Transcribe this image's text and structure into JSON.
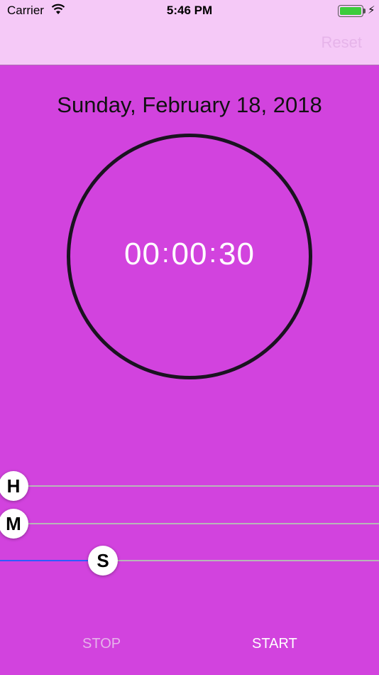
{
  "status_bar": {
    "carrier": "Carrier",
    "time": "5:46 PM",
    "battery_color": "#3ccc3c"
  },
  "nav": {
    "reset_label": "Reset"
  },
  "date": "Sunday, February 18, 2018",
  "timer": {
    "hours": "00",
    "minutes": "00",
    "seconds": "30",
    "separator": ":"
  },
  "sliders": [
    {
      "label": "H",
      "value": 0,
      "max": 23
    },
    {
      "label": "M",
      "value": 0,
      "max": 59
    },
    {
      "label": "S",
      "value": 30,
      "max": 59
    }
  ],
  "buttons": {
    "stop_label": "STOP",
    "start_label": "START"
  },
  "colors": {
    "background": "#d243de",
    "nav_background": "#f5c9f7",
    "slider_min_track": "#2e5cff",
    "slider_max_track": "#b7b7b7",
    "disabled_text": "#e6b4ea"
  }
}
